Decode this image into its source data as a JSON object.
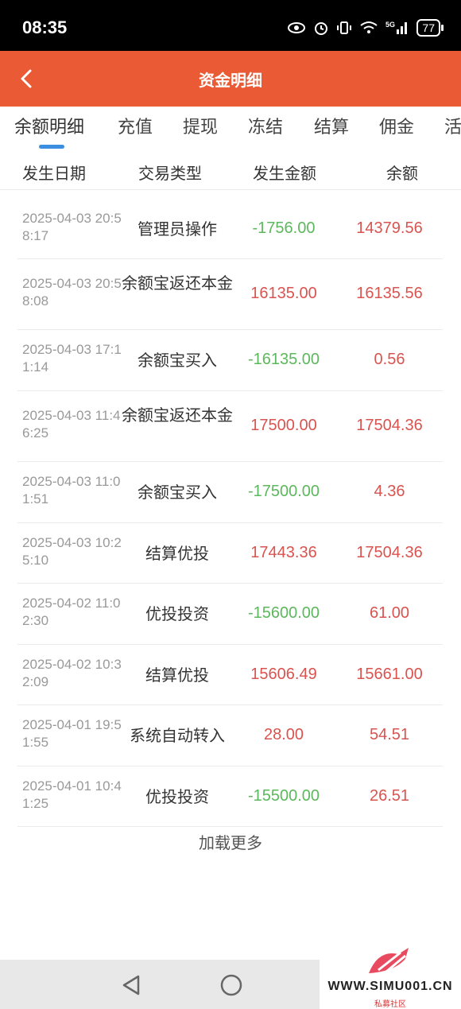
{
  "status_bar": {
    "time": "08:35",
    "battery": "77",
    "icons": [
      "eye-icon",
      "alarm-icon",
      "vibrate-icon",
      "wifi-icon",
      "signal-5g-icon",
      "battery-icon"
    ]
  },
  "header": {
    "title": "资金明细",
    "background": "#ea5a34"
  },
  "tabs": [
    {
      "label": "余额明细",
      "active": true
    },
    {
      "label": "充值"
    },
    {
      "label": "提现"
    },
    {
      "label": "冻结"
    },
    {
      "label": "结算"
    },
    {
      "label": "佣金"
    },
    {
      "label": "活"
    }
  ],
  "columns": [
    "发生日期",
    "交易类型",
    "发生金额",
    "余额"
  ],
  "rows": [
    {
      "date": "2025-04-03 20:58:17",
      "type": "管理员操作",
      "amount": "-1756.00",
      "balance": "14379.56",
      "sign": "neg"
    },
    {
      "date": "2025-04-03 20:58:08",
      "type": "余额宝返还本金",
      "amount": "16135.00",
      "balance": "16135.56",
      "sign": "pos"
    },
    {
      "date": "2025-04-03 17:11:14",
      "type": "余额宝买入",
      "amount": "-16135.00",
      "balance": "0.56",
      "sign": "neg"
    },
    {
      "date": "2025-04-03 11:46:25",
      "type": "余额宝返还本金",
      "amount": "17500.00",
      "balance": "17504.36",
      "sign": "pos"
    },
    {
      "date": "2025-04-03 11:01:51",
      "type": "余额宝买入",
      "amount": "-17500.00",
      "balance": "4.36",
      "sign": "neg"
    },
    {
      "date": "2025-04-03 10:25:10",
      "type": "结算优投",
      "amount": "17443.36",
      "balance": "17504.36",
      "sign": "pos"
    },
    {
      "date": "2025-04-02 11:02:30",
      "type": "优投投资",
      "amount": "-15600.00",
      "balance": "61.00",
      "sign": "neg"
    },
    {
      "date": "2025-04-02 10:32:09",
      "type": "结算优投",
      "amount": "15606.49",
      "balance": "15661.00",
      "sign": "pos"
    },
    {
      "date": "2025-04-01 19:51:55",
      "type": "系统自动转入",
      "amount": "28.00",
      "balance": "54.51",
      "sign": "pos"
    },
    {
      "date": "2025-04-01 10:41:25",
      "type": "优投投资",
      "amount": "-15500.00",
      "balance": "26.51",
      "sign": "neg"
    }
  ],
  "load_more": "加载更多",
  "colors": {
    "negative": "#5cb85c",
    "positive": "#d9534f",
    "tab_indicator": "#3b8ee0"
  },
  "watermark": {
    "text": "WWW.SIMU001.CN",
    "subtitle": "私募社区"
  }
}
